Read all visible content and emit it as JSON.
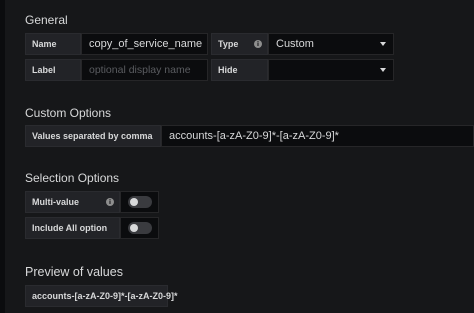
{
  "general": {
    "heading": "General",
    "name_label": "Name",
    "name_value": "copy_of_service_name",
    "type_label": "Type",
    "type_value": "Custom",
    "label_label": "Label",
    "label_placeholder": "optional display name",
    "hide_label": "Hide",
    "hide_value": ""
  },
  "custom_options": {
    "heading": "Custom Options",
    "values_label": "Values separated by comma",
    "values_value": "accounts-[a-zA-Z0-9]*-[a-zA-Z0-9]*"
  },
  "selection_options": {
    "heading": "Selection Options",
    "multi_value_label": "Multi-value",
    "multi_value_on": false,
    "include_all_label": "Include All option",
    "include_all_on": false
  },
  "preview": {
    "heading": "Preview of values",
    "values": [
      "accounts-[a-zA-Z0-9]*-[a-zA-Z0-9]*"
    ]
  },
  "icons": {
    "type_info": "info-icon",
    "multi_value_info": "info-icon",
    "type_dropdown": "chevron-down-icon",
    "hide_dropdown": "chevron-down-icon"
  }
}
